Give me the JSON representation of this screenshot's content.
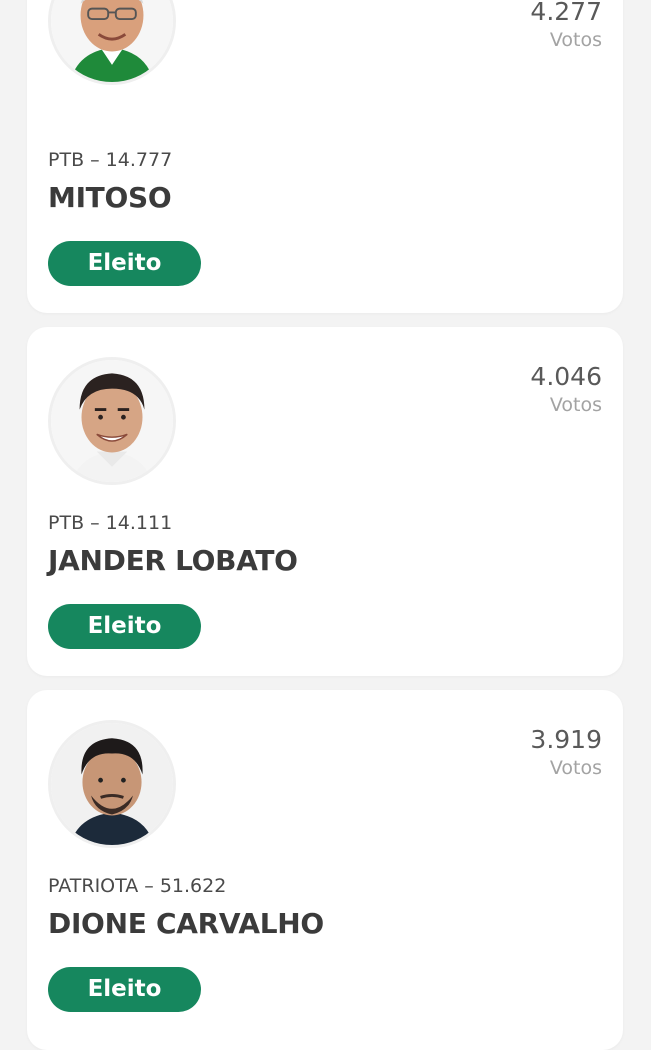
{
  "colors": {
    "page_background": "#f3f3f3",
    "card_background": "#ffffff",
    "badge": "#16875e",
    "name_text": "#3b3b3b",
    "votes_label": "#a3a3a3"
  },
  "candidates": [
    {
      "party_line": "PTB – 14.777",
      "name": "MITOSO",
      "votes": "4.277",
      "votes_label": "Votos",
      "status": "Eleito",
      "photo": "candidate-photo-icon"
    },
    {
      "party_line": "PTB – 14.111",
      "name": "JANDER LOBATO",
      "votes": "4.046",
      "votes_label": "Votos",
      "status": "Eleito",
      "photo": "candidate-photo-icon"
    },
    {
      "party_line": "PATRIOTA – 51.622",
      "name": "DIONE CARVALHO",
      "votes": "3.919",
      "votes_label": "Votos",
      "status": "Eleito",
      "photo": "candidate-photo-icon"
    }
  ]
}
